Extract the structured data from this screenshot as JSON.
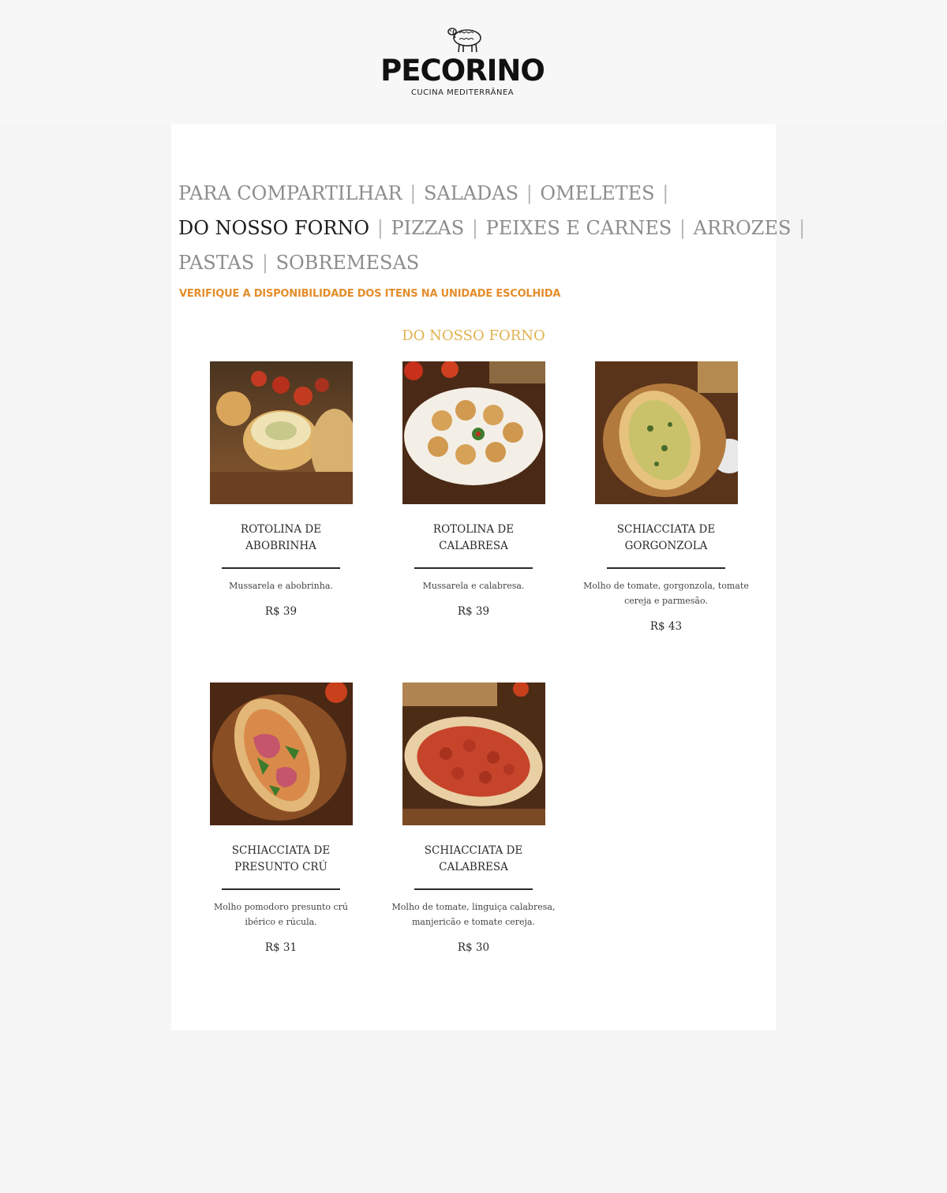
{
  "brand": {
    "name": "PECORINO",
    "tagline": "CUCINA MEDITERRÂNEA"
  },
  "nav": {
    "lines": [
      [
        {
          "label": "PARA COMPARTILHAR",
          "active": false
        },
        {
          "label": "SALADAS",
          "active": false
        },
        {
          "label": "OMELETES",
          "active": false
        }
      ],
      [
        {
          "label": "DO NOSSO FORNO",
          "active": true
        },
        {
          "label": "PIZZAS",
          "active": false
        },
        {
          "label": "PEIXES E CARNES",
          "active": false
        },
        {
          "label": "ARROZES",
          "active": false
        }
      ],
      [
        {
          "label": "PASTAS",
          "active": false
        },
        {
          "label": "SOBREMESAS",
          "active": false
        }
      ]
    ],
    "separator": "|"
  },
  "notice": "VERIFIQUE A DISPONIBILIDADE DOS ITENS NA UNIDADE ESCOLHIDA",
  "section_title": "DO NOSSO FORNO",
  "items": [
    {
      "name_line1": "ROTOLINA DE",
      "name_line2": "ABOBRINHA",
      "desc": "Mussarela e abobrinha.",
      "price": "R$  39",
      "photo": "rotolina-abobrinha"
    },
    {
      "name_line1": "ROTOLINA DE",
      "name_line2": "CALABRESA",
      "desc": "Mussarela e calabresa.",
      "price": "R$  39",
      "photo": "rotolina-calabresa"
    },
    {
      "name_line1": "SCHIACCIATA DE",
      "name_line2": "GORGONZOLA",
      "desc": "Molho de tomate, gorgonzola, tomate cereja e parmesão.",
      "price": "R$  43",
      "photo": "schiacciata-gorgonzola"
    },
    {
      "name_line1": "SCHIACCIATA DE",
      "name_line2": "PRESUNTO CRÚ",
      "desc": "Molho pomodoro presunto crú ibérico e rúcula.",
      "price": "R$  31",
      "photo": "schiacciata-presunto"
    },
    {
      "name_line1": "SCHIACCIATA DE",
      "name_line2": "CALABRESA",
      "desc": "Molho de tomate, linguiça calabresa, manjericão e tomate cereja.",
      "price": "R$  30",
      "photo": "schiacciata-calabresa"
    }
  ],
  "colors": {
    "accent_orange": "#e58d2a",
    "accent_gold": "#e0b24e",
    "nav_inactive": "#8d8d8d",
    "nav_active": "#1c1c1c"
  }
}
